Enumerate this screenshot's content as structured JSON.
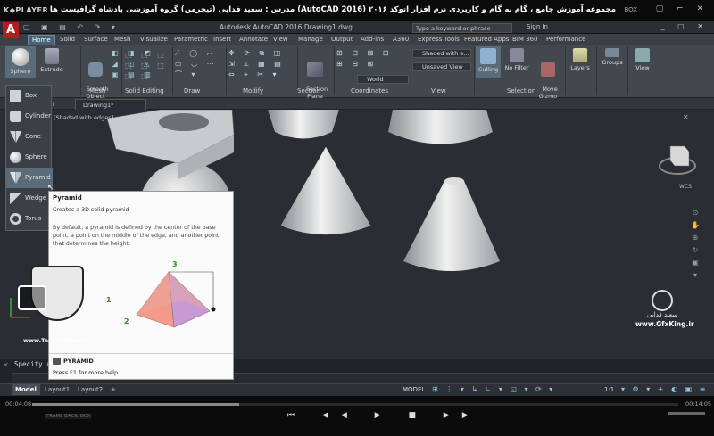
{
  "player": {
    "logo": "K◆PLAYER",
    "title": "مجموعه آموزش جامع ، گام به گام و کاربردی نرم افزار اتوکد ۲۰۱۶ (AutoCAD 2016) مدرس : سعید فدایی (تیچرمن) گروه آموزشی پادشاه گرافیست ها",
    "box_label": "BOX",
    "window_controls": "▢ ⌐ ✕",
    "time_current": "00:04:08",
    "time_total": "00:14:05",
    "bottom_tags": [
      "FRAME",
      "BACK",
      "BOX"
    ],
    "progress": 0.32,
    "controls": "⏮ ◀◀ ▶ ■ ▶▶"
  },
  "autocad": {
    "app_letter": "A",
    "qat": "▢ ▣ ▤ ↶ ↷ ▾",
    "title": "Autodesk AutoCAD 2016    Drawing1.dwg",
    "search_placeholder": "Type a keyword or phrase",
    "signin": "Sign In",
    "window_controls": "_ ▢ ✕",
    "tabs": [
      "Home",
      "Solid",
      "Surface",
      "Mesh",
      "Visualize",
      "Parametric",
      "Insert",
      "Annotate",
      "View",
      "Manage",
      "Output",
      "Add-ins",
      "A360",
      "Express Tools",
      "Featured Apps",
      "BIM 360",
      "Performance"
    ],
    "active_tab": "Home",
    "ribbon": {
      "sphere": "Sphere",
      "extrude": "Extrude",
      "smooth_object": "Smooth\nObject",
      "section_plane": "Section\nPlane",
      "culling": "Culling",
      "no_filter": "No Filter",
      "move_gizmo": "Move\nGizmo",
      "layers": "Layers",
      "groups": "Groups",
      "view": "View",
      "visual_style": "Shaded with e...",
      "view_saved": "Unsaved View",
      "ucs": "World",
      "panels": [
        "Mesh",
        "Solid Editing",
        "Draw",
        "Modify",
        "Section",
        "Coordinates",
        "View",
        "Selection"
      ]
    },
    "doc_tabs": {
      "start": "Start",
      "drawing": "Drawing1*"
    },
    "viewport_label": "[Shaded with edges]",
    "wcs": "WCS",
    "dropdown": [
      {
        "label": "Box",
        "icon": "box-icon"
      },
      {
        "label": "Cylinder",
        "icon": "cylinder-icon"
      },
      {
        "label": "Cone",
        "icon": "cone-icon"
      },
      {
        "label": "Sphere",
        "icon": "sphere-icon"
      },
      {
        "label": "Pyramid",
        "icon": "pyramid-icon"
      },
      {
        "label": "Wedge",
        "icon": "wedge-icon"
      },
      {
        "label": "Torus",
        "icon": "torus-icon"
      }
    ],
    "tooltip": {
      "title": "Pyramid",
      "subtitle": "Creates a 3D solid pyramid",
      "body": "By default, a pyramid is defined by the center of the base point, a point on the middle of the edge, and another point that determines the height.",
      "diagram_labels": [
        "1",
        "2",
        "3"
      ],
      "command": "PYRAMID",
      "help": "Press F1 for more help"
    },
    "command_line": {
      "specify": "Specify r",
      "input_prompt": "▸_"
    },
    "layout_tabs": [
      "Model",
      "Layout1",
      "Layout2",
      "+"
    ],
    "status_model": "MODEL",
    "zoom_scale": "1:1",
    "status_icons_left": "⊞ ⋮ ▾ ↳ ∟ ▾ ◱ ▾ ⟳ ▾",
    "status_icons_right": "▾ ⚙ ▾ + ◐ ▣ ≡"
  },
  "watermarks": {
    "teacher": "www.TeacherMan.ir",
    "gfx": "www.GfxKing.ir",
    "gfx_name": "سعید فدایی"
  }
}
